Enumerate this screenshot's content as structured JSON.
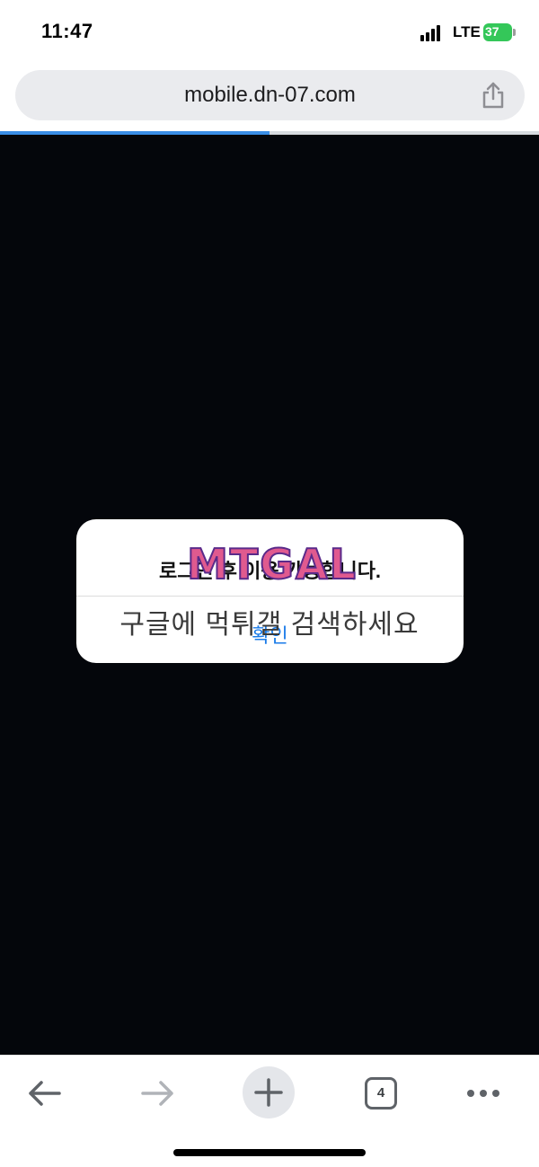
{
  "status_bar": {
    "time": "11:47",
    "network": "LTE",
    "battery": "37"
  },
  "browser": {
    "url": "mobile.dn-07.com",
    "load_progress": 0.5
  },
  "alert": {
    "message": "로그인 후 이용 가능합니다.",
    "confirm_label": "확인"
  },
  "watermark": {
    "logo_text": "MTGAL",
    "caption": "구글에 먹튀갤 검색하세요"
  },
  "toolbar": {
    "tab_count": "4"
  },
  "colors": {
    "content_bg": "#04060b",
    "accent": "#1a7be8",
    "progress": "#3a8ee6",
    "battery": "#34c759"
  }
}
